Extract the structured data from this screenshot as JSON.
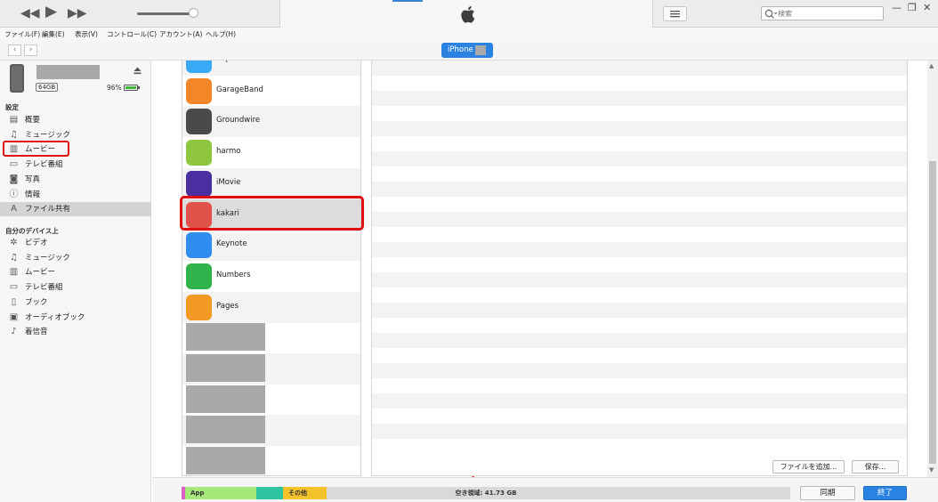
{
  "player": {
    "rewind_icon": "rewind-icon",
    "play_icon": "play-icon",
    "forward_icon": "fast-forward-icon",
    "volume_level": 0.95
  },
  "search": {
    "placeholder": "検索"
  },
  "window_controls": {
    "minimize": "—",
    "restore": "❐",
    "close": "✕"
  },
  "menu": [
    "ファイル(F)",
    "編集(E)",
    "表示(V)",
    "コントロール(C)",
    "アカウント(A)",
    "ヘルプ(H)"
  ],
  "nav": {
    "back": "‹",
    "forward": "›"
  },
  "device": {
    "pill_label": "iPhone",
    "capacity": "64GB",
    "battery_pct": "96%",
    "battery_level": 0.96
  },
  "sidebar": {
    "settings_header": "設定",
    "settings_items": [
      {
        "label": "概要",
        "icon": "summary-icon"
      },
      {
        "label": "ミュージック",
        "icon": "music-note-icon"
      },
      {
        "label": "ムービー",
        "icon": "film-icon"
      },
      {
        "label": "テレビ番組",
        "icon": "tv-icon"
      },
      {
        "label": "写真",
        "icon": "camera-icon"
      },
      {
        "label": "情報",
        "icon": "info-icon"
      },
      {
        "label": "ファイル共有",
        "icon": "app-store-icon",
        "selected": true
      }
    ],
    "ondevice_header": "自分のデバイス上",
    "ondevice_items": [
      {
        "label": "ビデオ",
        "icon": "video-gear-icon"
      },
      {
        "label": "ミュージック",
        "icon": "music-note-icon"
      },
      {
        "label": "ムービー",
        "icon": "film-icon"
      },
      {
        "label": "テレビ番組",
        "icon": "tv-icon"
      },
      {
        "label": "ブック",
        "icon": "book-icon"
      },
      {
        "label": "オーディオブック",
        "icon": "audiobook-icon"
      },
      {
        "label": "着信音",
        "icon": "bell-icon"
      }
    ]
  },
  "apps": [
    {
      "label": "Clips",
      "icon": "clips-icon",
      "color": "#39a9f5"
    },
    {
      "label": "GarageBand",
      "icon": "garageband-icon",
      "color": "#f4862a"
    },
    {
      "label": "Groundwire",
      "icon": "groundwire-icon",
      "color": "#4a4a4a"
    },
    {
      "label": "harmo",
      "icon": "harmo-icon",
      "color": "#8fc63f"
    },
    {
      "label": "iMovie",
      "icon": "imovie-icon",
      "color": "#4b2fa0"
    },
    {
      "label": "kakari",
      "icon": "kakari-icon",
      "color": "#e0524a",
      "selected": true
    },
    {
      "label": "Keynote",
      "icon": "keynote-icon",
      "color": "#2f8df0"
    },
    {
      "label": "Numbers",
      "icon": "numbers-icon",
      "color": "#2fb34a"
    },
    {
      "label": "Pages",
      "icon": "pages-icon",
      "color": "#f39a24"
    }
  ],
  "documents": {
    "add_file_label": "ファイルを追加...",
    "save_label": "保存..."
  },
  "storage": {
    "app_label": "App",
    "other_label": "その他",
    "free_label": "空き領域: 41.73 GB",
    "colors": {
      "pink": "#e05cc8",
      "app": "#a7e87a",
      "teal": "#2ec4a0",
      "other": "#f4c32c",
      "free": "#d9d9d9"
    }
  },
  "actions": {
    "sync_label": "同期",
    "done_label": "終了"
  }
}
